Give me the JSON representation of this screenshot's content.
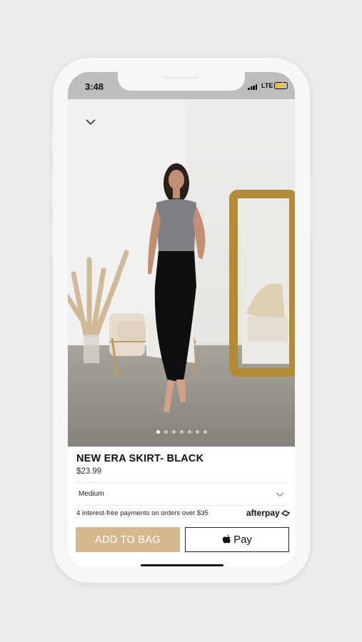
{
  "status_bar": {
    "time": "3:48",
    "network": "LTE"
  },
  "product": {
    "name": "NEW ERA SKIRT- BLACK",
    "price": "$23.99",
    "image_count": 7,
    "active_image": 1
  },
  "size": {
    "selected": "Medium"
  },
  "afterpay": {
    "text": "4 interest-free payments on orders over $35",
    "logo": "afterpay"
  },
  "actions": {
    "add_to_bag": "ADD TO BAG",
    "apple_pay": "Pay"
  },
  "colors": {
    "accent": "#d4b98f",
    "status_bar": "#bdbdbd",
    "battery": "#e8c400"
  },
  "icons": [
    "chevron-down-icon",
    "signal-icon",
    "battery-icon",
    "apple-icon",
    "afterpay-icon"
  ]
}
